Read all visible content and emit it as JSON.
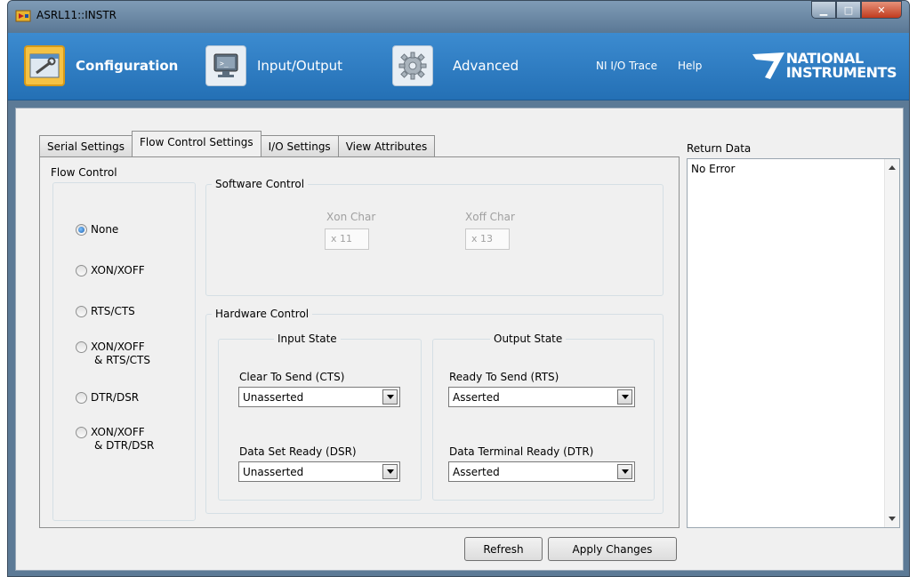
{
  "window": {
    "title": "ASRL11::INSTR"
  },
  "toolbar": {
    "configuration": "Configuration",
    "input_output": "Input/Output",
    "advanced": "Advanced",
    "ni_io_trace": "NI I/O Trace",
    "help": "Help",
    "logo_line1": "NATIONAL",
    "logo_line2": "INSTRUMENTS"
  },
  "tabs": [
    "Serial Settings",
    "Flow Control Settings",
    "I/O Settings",
    "View Attributes"
  ],
  "active_tab": "Flow Control Settings",
  "flow_control": {
    "title": "Flow Control",
    "options": [
      {
        "label": "None",
        "selected": true
      },
      {
        "label": "XON/XOFF",
        "selected": false
      },
      {
        "label": "RTS/CTS",
        "selected": false
      },
      {
        "label_line1": "XON/XOFF",
        "label_line2": "& RTS/CTS",
        "selected": false
      },
      {
        "label": "DTR/DSR",
        "selected": false
      },
      {
        "label_line1": "XON/XOFF",
        "label_line2": "& DTR/DSR",
        "selected": false
      }
    ]
  },
  "software_control": {
    "title": "Software Control",
    "xon_label": "Xon Char",
    "xon_value": "x 11",
    "xoff_label": "Xoff Char",
    "xoff_value": "x 13"
  },
  "hardware_control": {
    "title": "Hardware Control",
    "input_state": {
      "title": "Input State",
      "cts_label": "Clear To Send (CTS)",
      "cts_value": "Unasserted",
      "dsr_label": "Data Set Ready (DSR)",
      "dsr_value": "Unasserted"
    },
    "output_state": {
      "title": "Output State",
      "rts_label": "Ready To Send (RTS)",
      "rts_value": "Asserted",
      "dtr_label": "Data Terminal Ready (DTR)",
      "dtr_value": "Asserted"
    }
  },
  "return_data": {
    "label": "Return Data",
    "value": "No Error"
  },
  "buttons": {
    "refresh": "Refresh",
    "apply": "Apply Changes"
  },
  "colors": {
    "toolbar": "#2a7bc2",
    "titlebar": "#6f8cab",
    "panel": "#f0f0f0",
    "config_icon": "#f5c244"
  }
}
